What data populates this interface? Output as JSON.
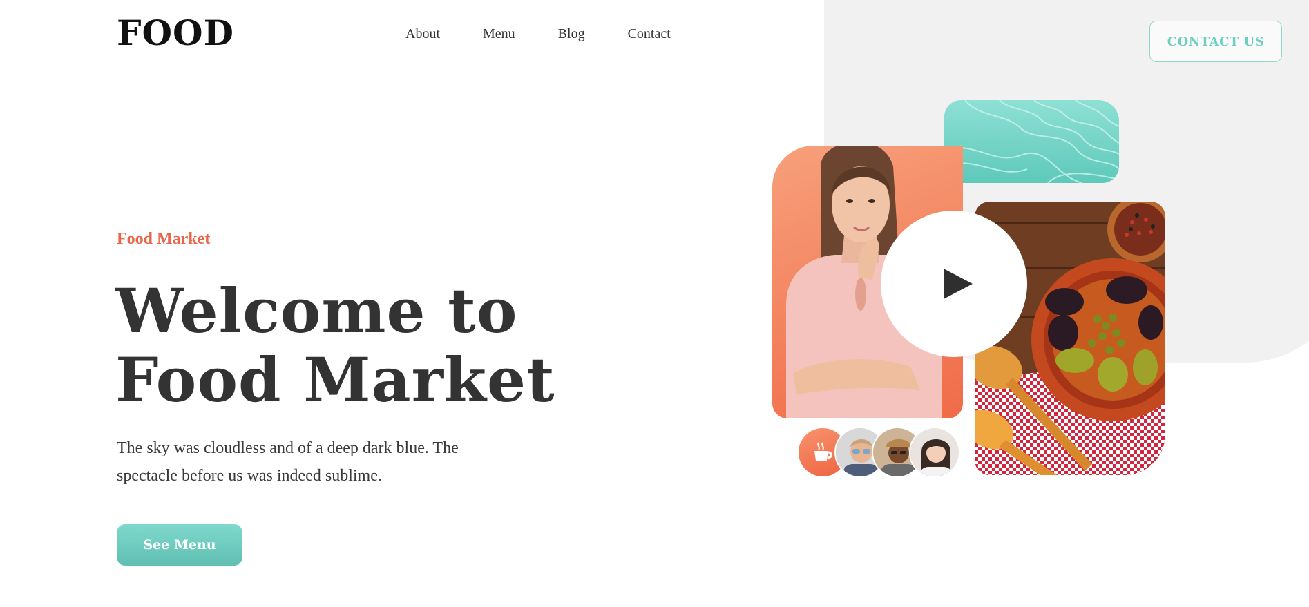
{
  "brand": {
    "logo": "FOOD"
  },
  "nav": {
    "items": [
      "About",
      "Menu",
      "Blog",
      "Contact"
    ]
  },
  "header": {
    "cta_label": "CONTACT US"
  },
  "hero": {
    "eyebrow": "Food Market",
    "title_line1": "Welcome to",
    "title_line2": "Food Market",
    "description": "The sky was cloudless and of a deep dark blue. The spectacle before us was indeed sublime.",
    "button_label": "See Menu"
  },
  "avatars": {
    "badge_icon": "coffee-cup-icon",
    "people": [
      "avatar-man-glasses",
      "avatar-man-cap",
      "avatar-woman"
    ]
  },
  "colors": {
    "accent": "#e8654a",
    "teal": "#6ccfc0",
    "text": "#333333"
  }
}
